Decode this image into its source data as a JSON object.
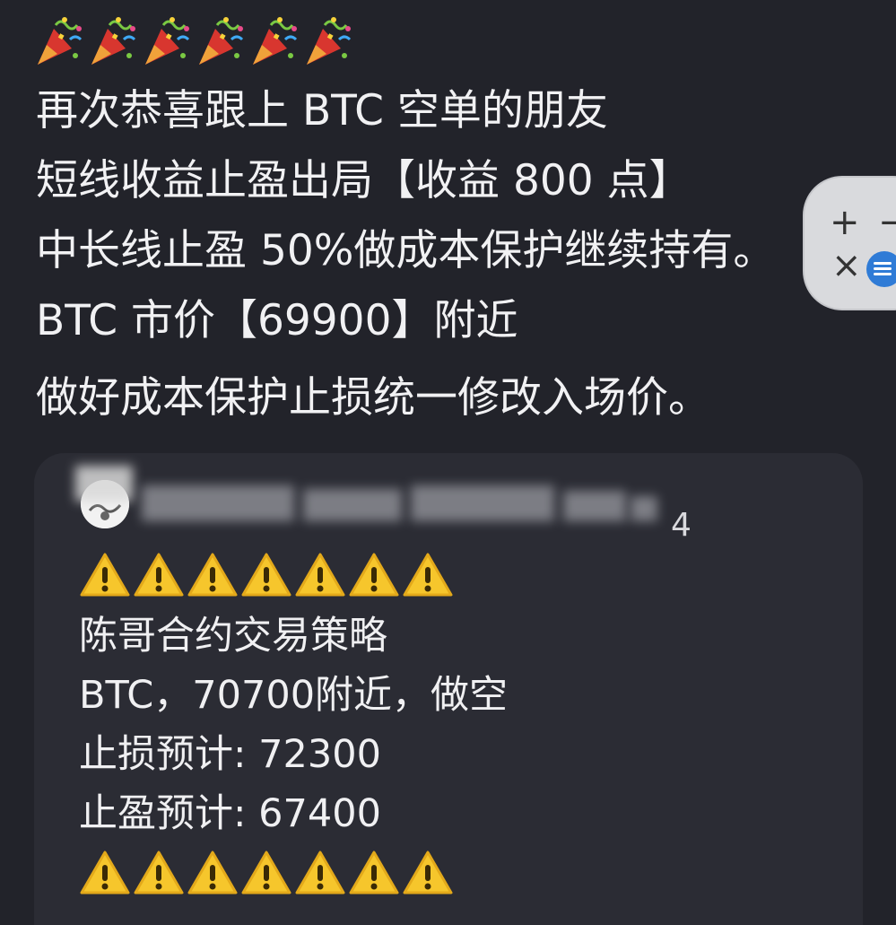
{
  "message": {
    "emoji_count": 6,
    "emoji_name": "party-popper-icon",
    "lines": [
      "再次恭喜跟上 BTC 空单的朋友",
      "短线收益止盈出局【收益 800 点】",
      "中长线止盈 50%做成本保护继续持有。",
      "BTC 市价【69900】附近",
      "做好成本保护止损统一修改入场价。"
    ]
  },
  "quote": {
    "time_fragment": "4",
    "warning_icon": "warning-icon",
    "lines": [
      "陈哥合约交易策略",
      "BTC，70700附近，做空",
      "止损预计: 72300",
      "止盈预计: 67400"
    ]
  },
  "zoom_widget": {
    "plus_label": "+",
    "minus_label": "−",
    "close_label": "×"
  },
  "colors": {
    "background": "#22232a",
    "card": "#2b2c34",
    "warning_yellow": "#f6c62c",
    "accent_blue": "#2f7bd6"
  }
}
